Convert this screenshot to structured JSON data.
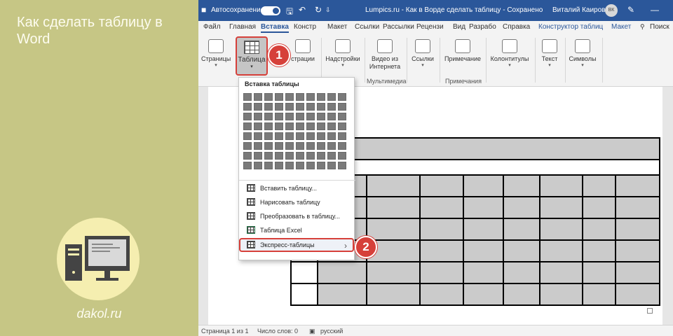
{
  "promo": {
    "title": "Как сделать таблицу в Word",
    "site": "dakol.ru"
  },
  "titlebar": {
    "autosave_label": "Автосохранение",
    "doc_title": "Lumpics.ru - Как в Ворде сделать таблицу - Сохранено",
    "user_name": "Виталий Каиров",
    "user_initials": "ВК"
  },
  "tabs": [
    {
      "label": "Файл"
    },
    {
      "label": "Главная"
    },
    {
      "label": "Вставка"
    },
    {
      "label": "Констр"
    },
    {
      "label": "Макет"
    },
    {
      "label": "Ссылки"
    },
    {
      "label": "Рассылки"
    },
    {
      "label": "Рецензи"
    },
    {
      "label": "Вид"
    },
    {
      "label": "Разрабо"
    },
    {
      "label": "Справка"
    },
    {
      "label": "Конструктор таблиц"
    },
    {
      "label": "Макет"
    },
    {
      "label": "Поиск"
    }
  ],
  "ribbon": {
    "pages": "Страницы",
    "table": "Таблица",
    "illustrations": "страции",
    "addins": "Надстройки",
    "video": "Видео из Интернета",
    "links": "Ссылки",
    "comment": "Примечание",
    "headers": "Колонтитулы",
    "text": "Текст",
    "symbols": "Символы",
    "group_media": "Мультимедиа",
    "group_comments": "Примечания"
  },
  "dropdown": {
    "header": "Вставка таблицы",
    "items": [
      {
        "label": "Вставить таблицу..."
      },
      {
        "label": "Нарисовать таблицу"
      },
      {
        "label": "Преобразовать в таблицу..."
      },
      {
        "label": "Таблица Excel"
      },
      {
        "label": "Экспресс-таблицы"
      }
    ]
  },
  "callouts": {
    "one": "1",
    "two": "2"
  },
  "status": {
    "page": "Страница 1 из 1",
    "words": "Число слов: 0",
    "language": "русский"
  },
  "colors": {
    "word_blue": "#2b579a",
    "highlight_red": "#d6403a",
    "promo_bg": "#c6c685"
  }
}
